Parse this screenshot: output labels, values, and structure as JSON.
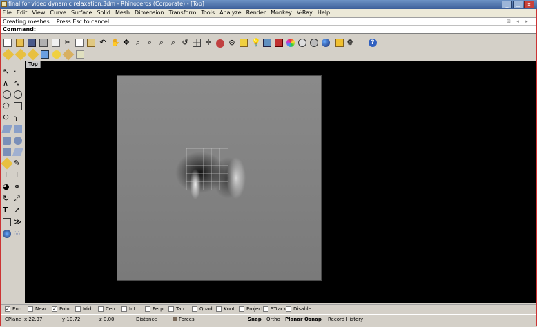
{
  "window": {
    "title": "final for video dynamic relaxation.3dm - Rhinoceros (Corporate) - [Top]",
    "controls": [
      "_",
      "□",
      "×"
    ]
  },
  "menu": [
    "File",
    "Edit",
    "View",
    "Curve",
    "Surface",
    "Solid",
    "Mesh",
    "Dimension",
    "Transform",
    "Tools",
    "Analyze",
    "Render",
    "Monkey",
    "V-Ray",
    "Help"
  ],
  "command": {
    "history": "Creating meshes... Press Esc to cancel",
    "prompt": "Command:"
  },
  "viewport": {
    "tab_label": "Top"
  },
  "osnaps": [
    {
      "label": "End",
      "checked": true
    },
    {
      "label": "Near",
      "checked": false
    },
    {
      "label": "Point",
      "checked": true
    },
    {
      "label": "Mid",
      "checked": false
    },
    {
      "label": "Cen",
      "checked": false
    },
    {
      "label": "Int",
      "checked": false
    },
    {
      "label": "Perp",
      "checked": false
    },
    {
      "label": "Tan",
      "checked": false
    },
    {
      "label": "Quad",
      "checked": false
    },
    {
      "label": "Knot",
      "checked": false
    },
    {
      "label": "Project",
      "checked": false
    },
    {
      "label": "STrack",
      "checked": false
    },
    {
      "label": "Disable",
      "checked": false
    }
  ],
  "status": {
    "cplane": "CPlane",
    "x": "x 22.37",
    "y": "y 10.72",
    "z": "z 0.00",
    "distance": "Distance",
    "layer": "Forces",
    "snap": "Snap",
    "ortho": "Ortho",
    "planar": "Planar",
    "osnap": "Osnap",
    "record": "Record History"
  },
  "colors": {
    "layer_swatch": "#7a6a5a",
    "titlebar": "#3c5f99",
    "viewport_bg": "#000000"
  }
}
